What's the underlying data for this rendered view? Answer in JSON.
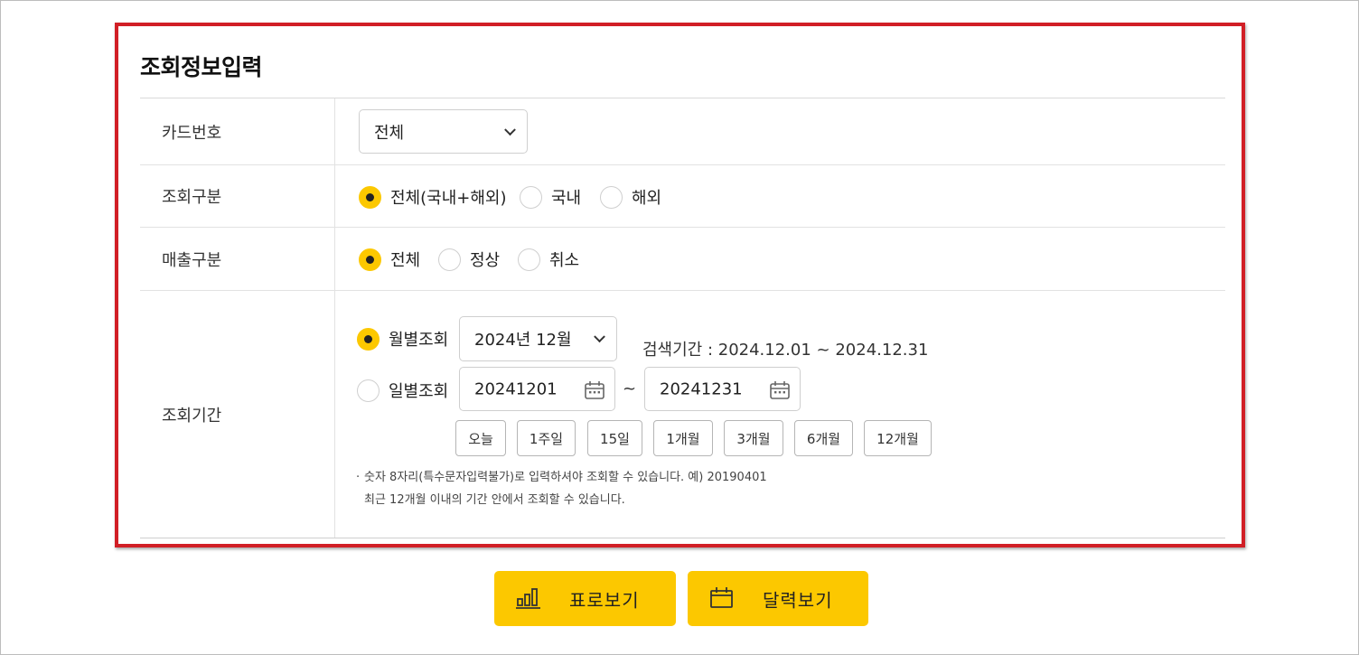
{
  "section": {
    "title": "조회정보입력"
  },
  "rows": {
    "card": {
      "label": "카드번호",
      "select_value": "전체"
    },
    "inquiry_type": {
      "label": "조회구분",
      "options": [
        "전체(국내+해외)",
        "국내",
        "해외"
      ],
      "selected": "전체(국내+해외)"
    },
    "sales_type": {
      "label": "매출구분",
      "options": [
        "전체",
        "정상",
        "취소"
      ],
      "selected": "전체"
    },
    "period": {
      "label": "조회기간",
      "monthly_label": "월별조회",
      "month_value": "2024년 12월",
      "range_text": "검색기간 : 2024.12.01 ~ 2024.12.31",
      "daily_label": "일별조회",
      "start_date": "20241201",
      "tilde": "~",
      "end_date": "20241231",
      "quick_buttons": [
        "오늘",
        "1주일",
        "15일",
        "1개월",
        "3개월",
        "6개월",
        "12개월"
      ],
      "note_line1": "숫자 8자리(특수문자입력불가)로 입력하셔야 조회할 수 있습니다. 예) 20190401",
      "note_line2": "최근 12개월 이내의 기간 안에서 조회할 수 있습니다.",
      "note_bullet": "·",
      "selected_mode": "월별조회"
    }
  },
  "actions": {
    "table_view": "표로보기",
    "calendar_view": "달력보기"
  },
  "colors": {
    "accent": "#fcc800",
    "highlight_border": "#d11f26"
  }
}
